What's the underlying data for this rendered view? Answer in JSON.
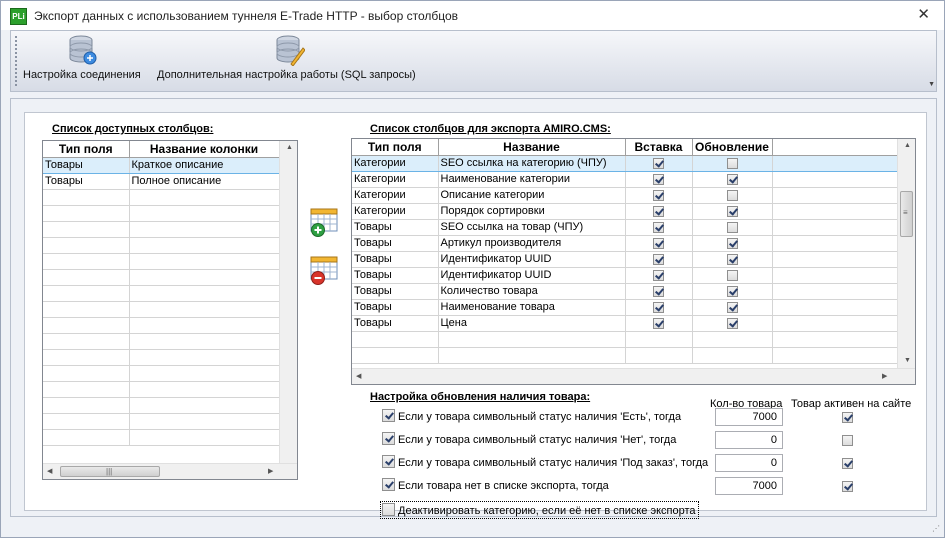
{
  "window": {
    "title": "Экспорт данных с использованием туннеля E-Trade HTTP - выбор столбцов",
    "icon_text": "PLi",
    "close_symbol": "✕"
  },
  "toolbar": {
    "connection_label": "Настройка соединения",
    "sql_label": "Дополнительная настройка работы (SQL запросы)"
  },
  "available": {
    "title": "Список доступных столбцов:",
    "columns": [
      "Тип поля",
      "Название колонки"
    ],
    "rows": [
      {
        "type": "Товары",
        "name": "Краткое описание",
        "selected": true
      },
      {
        "type": "Товары",
        "name": "Полное описание",
        "selected": false
      }
    ]
  },
  "export": {
    "title": "Список столбцов для экспорта AMIRO.CMS:",
    "columns": [
      "Тип поля",
      "Название",
      "Вставка",
      "Обновление"
    ],
    "rows": [
      {
        "type": "Категории",
        "name": "SEO ссылка на категорию (ЧПУ)",
        "insert": true,
        "update": false,
        "selected": true
      },
      {
        "type": "Категории",
        "name": "Наименование категории",
        "insert": true,
        "update": true
      },
      {
        "type": "Категории",
        "name": "Описание категории",
        "insert": true,
        "update": false
      },
      {
        "type": "Категории",
        "name": "Порядок сортировки",
        "insert": true,
        "update": true
      },
      {
        "type": "Товары",
        "name": "SEO ссылка на товар (ЧПУ)",
        "insert": true,
        "update": false
      },
      {
        "type": "Товары",
        "name": "Артикул производителя",
        "insert": true,
        "update": true
      },
      {
        "type": "Товары",
        "name": "Идентификатор UUID",
        "insert": true,
        "update": true
      },
      {
        "type": "Товары",
        "name": "Идентификатор UUID",
        "insert": true,
        "update": false
      },
      {
        "type": "Товары",
        "name": "Количество товара",
        "insert": true,
        "update": true
      },
      {
        "type": "Товары",
        "name": "Наименование товара",
        "insert": true,
        "update": true
      },
      {
        "type": "Товары",
        "name": "Цена",
        "insert": true,
        "update": true
      }
    ]
  },
  "stock": {
    "title": "Настройка обновления наличия товара:",
    "qty_header": "Кол-во товара",
    "active_header": "Товар активен на сайте",
    "rows": [
      {
        "label": "Если у товара символьный статус наличия 'Есть', тогда",
        "checked": true,
        "qty": "7000",
        "active": true
      },
      {
        "label": "Если у товара символьный статус наличия 'Нет', тогда",
        "checked": true,
        "qty": "0",
        "active": false
      },
      {
        "label": "Если у товара символьный статус наличия 'Под заказ', тогда",
        "checked": true,
        "qty": "0",
        "active": true
      },
      {
        "label": "Если товара нет в списке экспорта, тогда",
        "checked": true,
        "qty": "7000",
        "active": true
      }
    ],
    "deactivate_label": "Деактивировать категорию, если её нет в списке экспорта",
    "deactivate_checked": false
  },
  "colors": {
    "selection": "#dbeefb",
    "selection_border": "#6bb3e6",
    "add_icon": "#2ea043",
    "remove_icon": "#d9342b"
  }
}
